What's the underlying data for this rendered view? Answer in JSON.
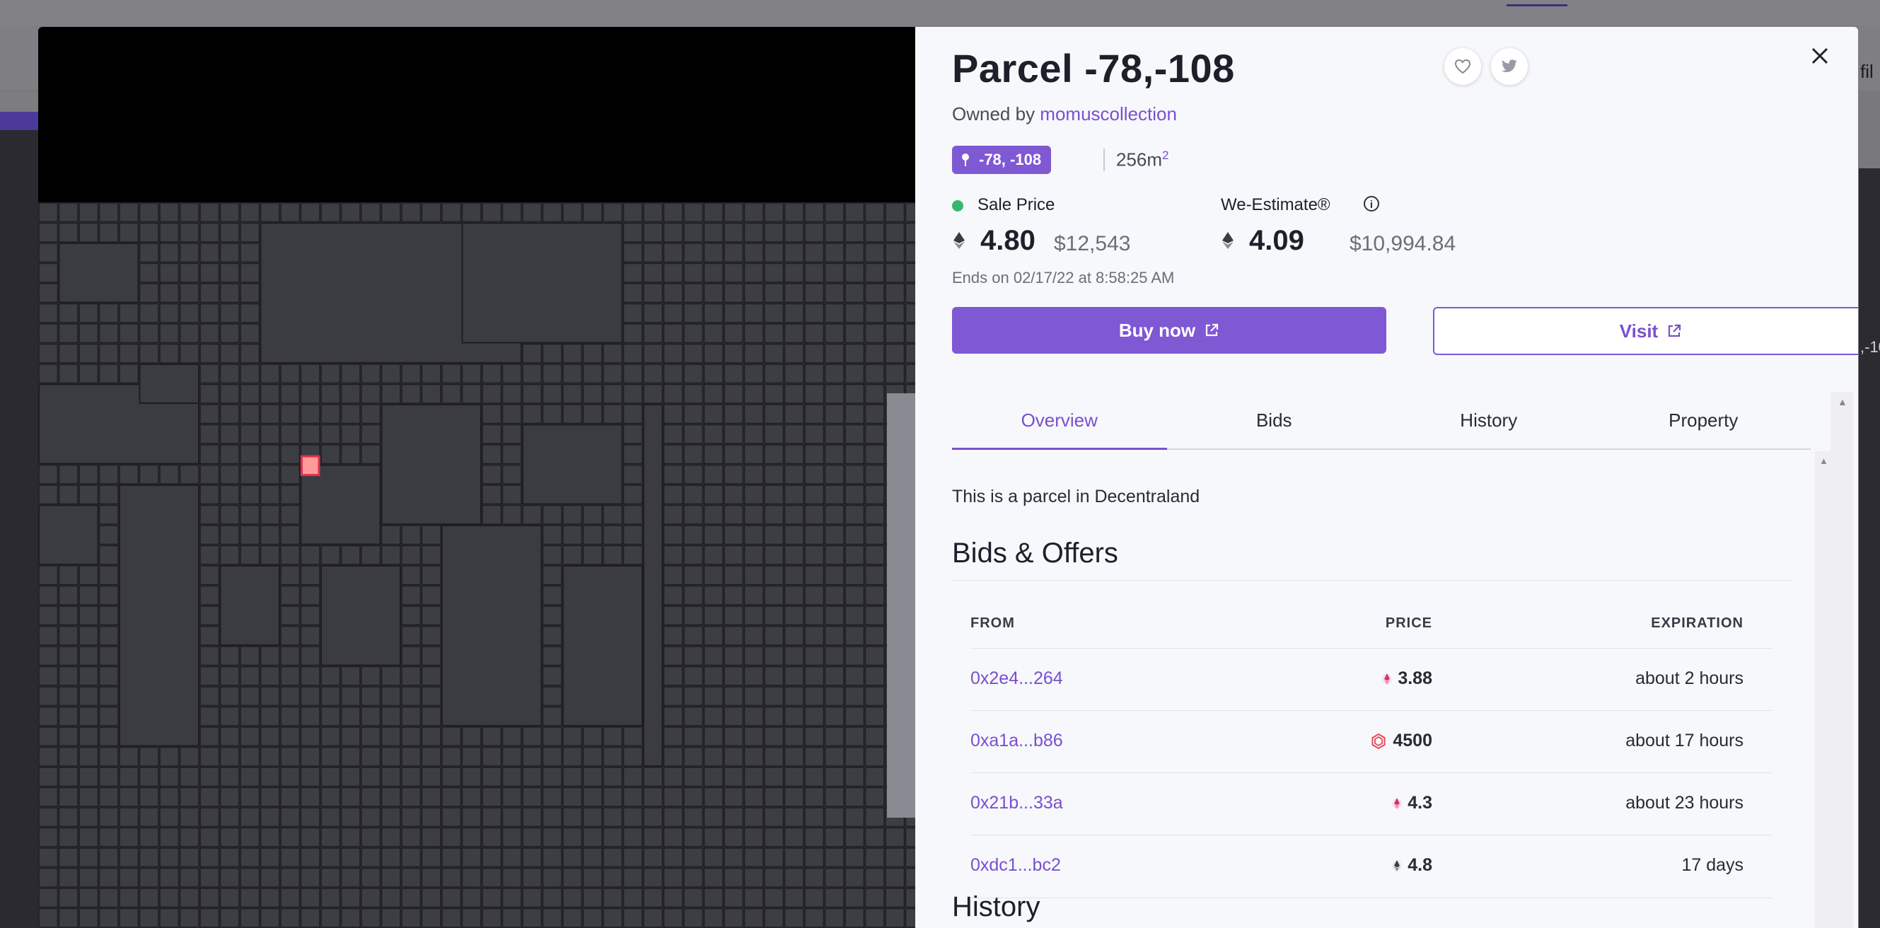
{
  "background": {
    "right_edge_text": "fil",
    "right_edge_coord": ",-10"
  },
  "parcel": {
    "title": "Parcel -78,-108",
    "owned_prefix": "Owned by ",
    "owner": "momuscollection",
    "coords": "-78, -108",
    "area": "256m",
    "area_unit_sup": "2"
  },
  "sale": {
    "label": "Sale Price",
    "price": "4.80",
    "usd": "$12,543",
    "ends": "Ends on 02/17/22 at 8:58:25 AM"
  },
  "estimate": {
    "label": "We-Estimate®",
    "price": "4.09",
    "usd": "$10,994.84"
  },
  "actions": {
    "buy_label": "Buy now",
    "visit_label": "Visit"
  },
  "tabs": [
    {
      "label": "Overview",
      "active": true
    },
    {
      "label": "Bids",
      "active": false
    },
    {
      "label": "History",
      "active": false
    },
    {
      "label": "Property",
      "active": false
    }
  ],
  "overview": {
    "description": "This is a parcel in Decentraland",
    "bids_title": "Bids & Offers",
    "history_title": "History"
  },
  "bids_table": {
    "headers": {
      "from": "FROM",
      "price": "PRICE",
      "expiration": "EXPIRATION"
    },
    "rows": [
      {
        "from": "0x2e4...264",
        "price": "3.88",
        "currency_icon": "eth-pink-icon",
        "expiration": "about 2 hours"
      },
      {
        "from": "0xa1a...b86",
        "price": "4500",
        "currency_icon": "mana-icon",
        "expiration": "about 17 hours"
      },
      {
        "from": "0x21b...33a",
        "price": "4.3",
        "currency_icon": "eth-pink-icon",
        "expiration": "about 23 hours"
      },
      {
        "from": "0xdc1...bc2",
        "price": "4.8",
        "currency_icon": "eth-icon",
        "expiration": "17 days"
      }
    ]
  },
  "colors": {
    "accent": "#7f58d4",
    "link": "#7b4fcf",
    "sale_dot": "#35b86e",
    "map_bg": "#3b3b42",
    "selected_parcel": "#ff9a9a"
  }
}
